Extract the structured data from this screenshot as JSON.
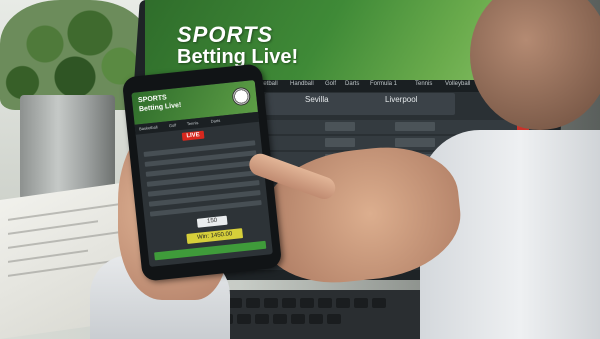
{
  "laptop": {
    "banner_title": "SPORTS",
    "banner_subtitle": "Betting Live!",
    "nav": [
      "Basketball",
      "Handball",
      "Golf",
      "Darts",
      "Formula 1",
      "Tennis",
      "Volleyball"
    ],
    "team_home": "Sevilla",
    "team_away": "Liverpool"
  },
  "phone": {
    "banner_title": "SPORTS",
    "banner_subtitle": "Betting Live!",
    "live_label": "LIVE",
    "stake": "150",
    "win": "Win: 1450.00"
  },
  "colors": {
    "banner_green": "#3f8a37",
    "live_red": "#d8281e",
    "win_yellow": "#d6cf3a",
    "place_green": "#3f9b3a"
  }
}
